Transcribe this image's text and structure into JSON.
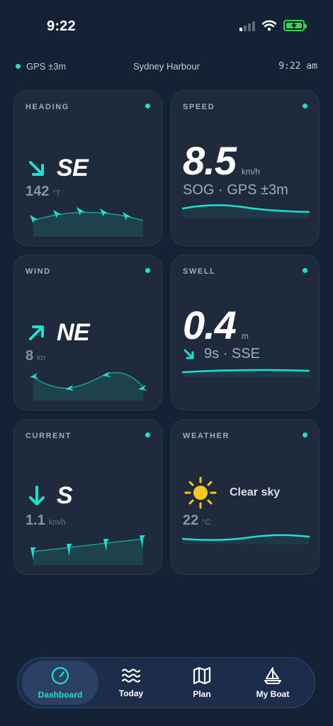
{
  "status_bar": {
    "time": "9:22"
  },
  "info_bar": {
    "gps": "GPS ±3m",
    "location": "Sydney Harbour",
    "clock": "9:22 am"
  },
  "colors": {
    "accent": "#19e3cf",
    "background": "#152236",
    "card": "#1f2a3c",
    "sun": "#f7c71a",
    "battery": "#39d353"
  },
  "cards": {
    "heading": {
      "title": "HEADING",
      "direction": "SE",
      "degrees": "142",
      "unit": "°T",
      "arrow": "arrow-down-right-icon"
    },
    "speed": {
      "title": "SPEED",
      "value": "8.5",
      "unit": "km/h",
      "description": "SOG · GPS ±3m"
    },
    "wind": {
      "title": "WIND",
      "direction": "NE",
      "value": "8",
      "unit": "kn",
      "arrow": "arrow-up-right-icon"
    },
    "swell": {
      "title": "SWELL",
      "value": "0.4",
      "unit": "m",
      "description": "9s · SSE",
      "arrow": "arrow-down-right-icon"
    },
    "current": {
      "title": "CURRENT",
      "direction": "S",
      "value": "1.1",
      "unit": "km/h",
      "arrow": "arrow-down-icon"
    },
    "weather": {
      "title": "WEATHER",
      "condition": "Clear sky",
      "temp": "22",
      "unit": "°C",
      "icon": "sun-icon"
    }
  },
  "nav": {
    "items": [
      {
        "label": "Dashboard",
        "icon": "gauge-icon",
        "active": true
      },
      {
        "label": "Today",
        "icon": "waves-icon",
        "active": false
      },
      {
        "label": "Plan",
        "icon": "map-icon",
        "active": false
      },
      {
        "label": "My Boat",
        "icon": "sailboat-icon",
        "active": false
      }
    ]
  }
}
